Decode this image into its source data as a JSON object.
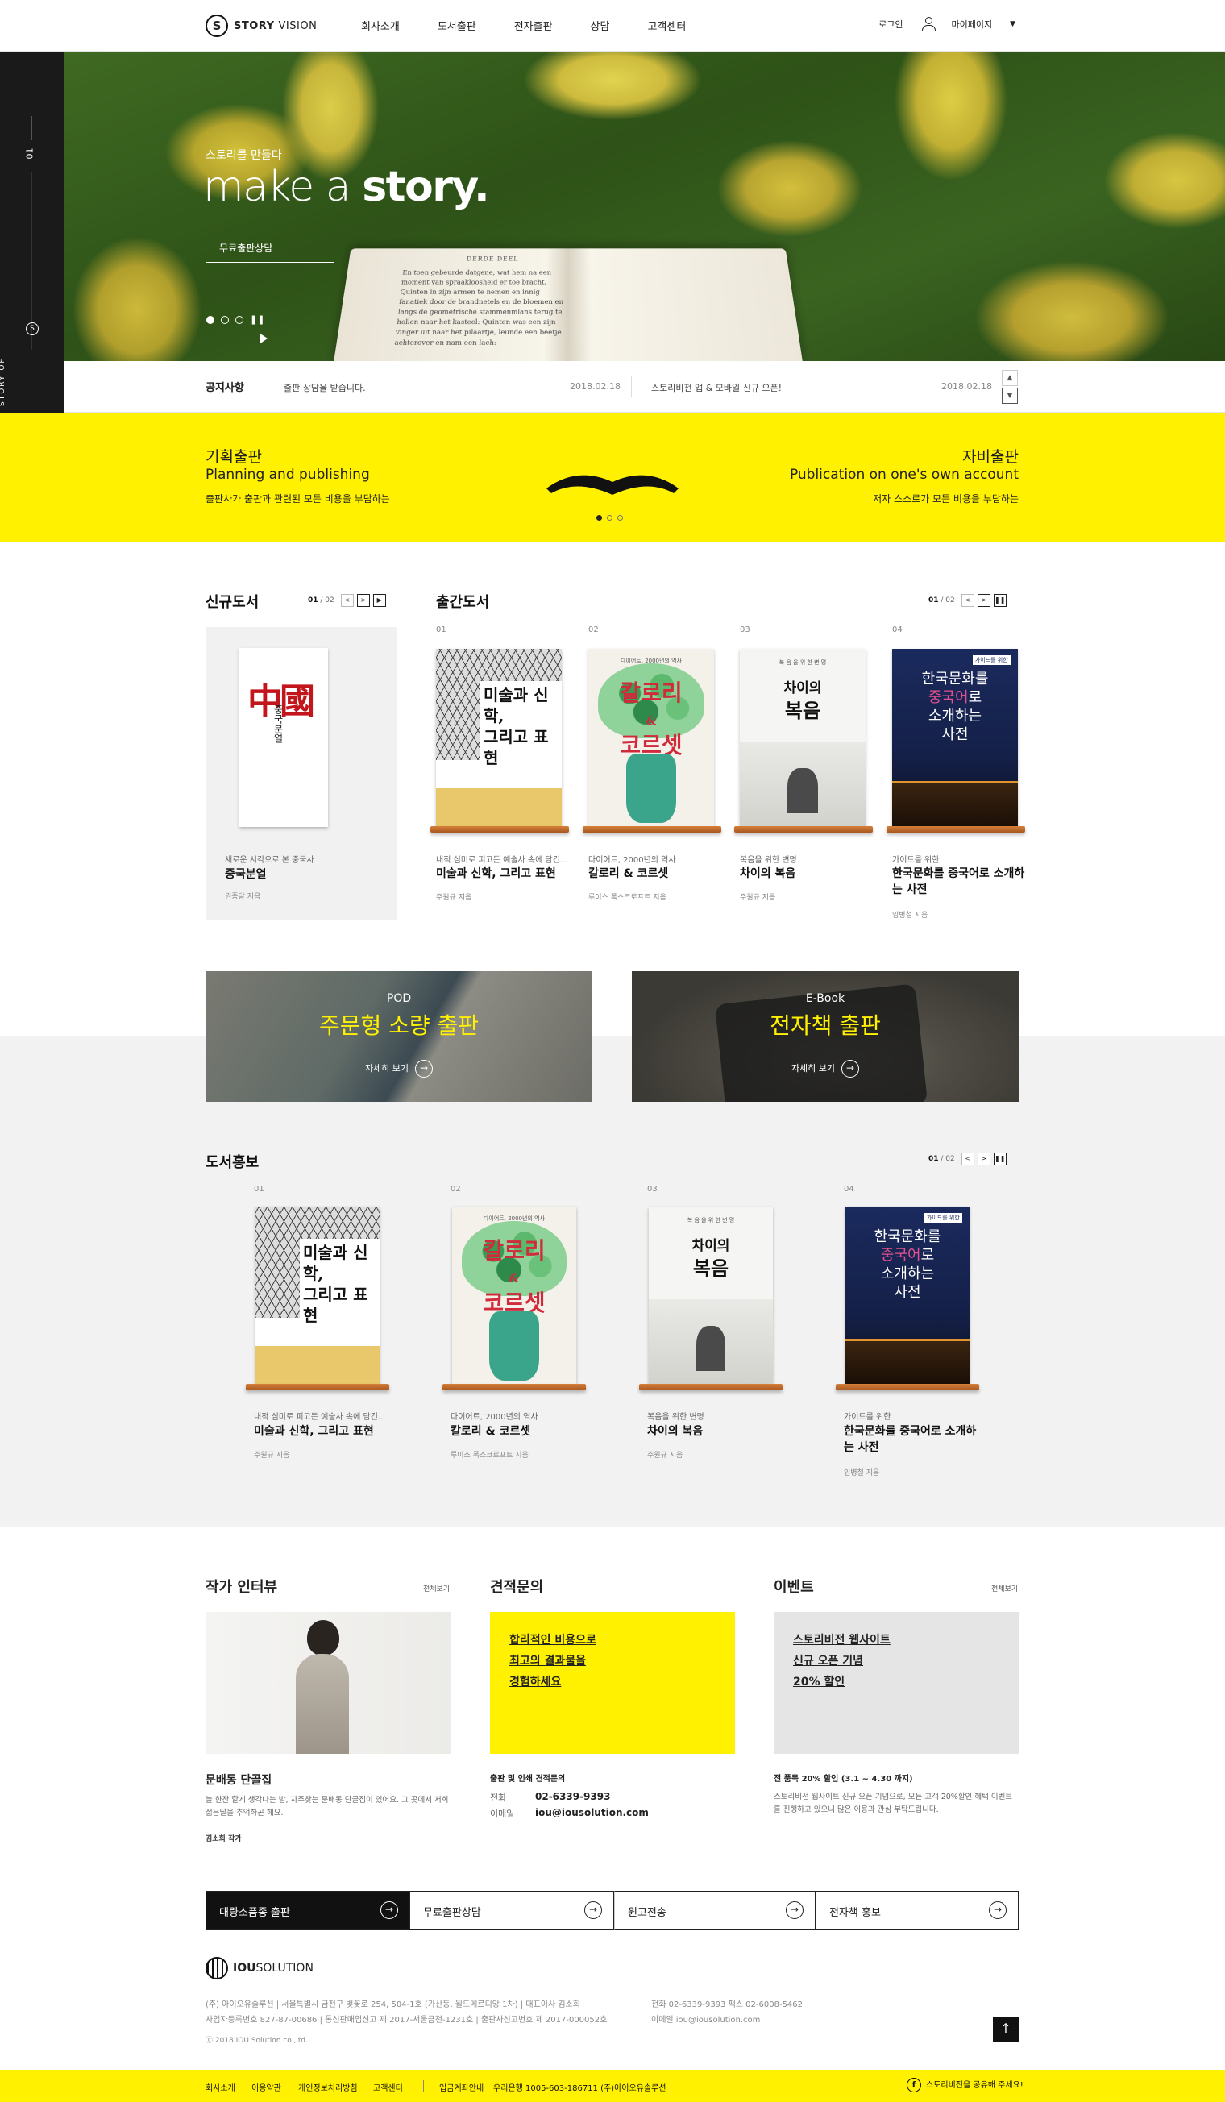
{
  "header": {
    "logo": {
      "brand_bold": "STORY",
      "brand_light": "VISION",
      "mark": "S"
    },
    "nav": [
      "회사소개",
      "도서출판",
      "전자출판",
      "상담",
      "고객센터"
    ],
    "login": "로그인",
    "mypage": "마이페이지"
  },
  "hero": {
    "page_num": "01",
    "vertical_text": "STORY OF",
    "subtitle": "스토리를 만들다",
    "title_light": "make a ",
    "title_bold": "story.",
    "cta": "무료출판상담",
    "slide_count": 3,
    "current_slide": 1,
    "book_heading": "DERDE DEEL",
    "book_text": "En toen gebeurde datgene, wat hem na een moment van spraakloosheid er toe bracht, Quinten in zijn armen te nemen en innig fanatiek door de brandnetels en de bloemen en langs de geometrische stammenmlans terug te hollen naar het kasteel: Quinten was een zijn vinger uit naar het pilaartje, leunde een beetje achterover en nam een lach:"
  },
  "notice": {
    "label": "공지사항",
    "items": [
      {
        "text": "출판 상담을 받습니다.",
        "date": "2018.02.18"
      },
      {
        "text": "스토리비전 앱 & 모바일 신규 오픈!",
        "date": "2018.02.18"
      }
    ],
    "up": "▲",
    "down": "▼"
  },
  "promo": {
    "left": {
      "title": "기획출판",
      "subtitle": "Planning and publishing",
      "desc": "출판사가 출판과 관련된 모든 비용을 부담하는"
    },
    "right": {
      "title": "자비출판",
      "subtitle": "Publication on one's own account",
      "desc": "저자 스스로가 모든 비용을 부담하는"
    },
    "dot_count": 3
  },
  "new_books": {
    "title": "신규도서",
    "page_cur": "01",
    "page_total": "02",
    "book": {
      "desc": "새로운 시각으로 본 중국사",
      "title": "중국분열",
      "author": "권중달 지음",
      "cover_text": "中國",
      "cover_sub": "중국분열"
    }
  },
  "released": {
    "title": "출간도서",
    "page_cur": "01",
    "page_total": "02",
    "books": [
      {
        "no": "01",
        "desc": "내적 심미로 피고든 예술사 속에 담긴...",
        "title": "미술과 신학, 그리고 표현",
        "author": "주원규 지음"
      },
      {
        "no": "02",
        "desc": "다이어트, 2000년의 역사",
        "title": "칼로리 & 코르셋",
        "author": "루이스 폭스크로프트 지음"
      },
      {
        "no": "03",
        "desc": "복음을 위한 변명",
        "title": "차이의 복음",
        "author": "주원규 지음"
      },
      {
        "no": "04",
        "desc": "가이드를 위한",
        "title": "한국문화를 중국어로 소개하는 사전",
        "author": "임병철 지음"
      }
    ]
  },
  "cover_text": {
    "art_title1": "미술과 신학,",
    "art_title2": "그리고 표현",
    "cal_top": "다이어트, 2000년의 역사",
    "cal_title1": "칼로리",
    "cal_amp": "&",
    "cal_title2": "코르셋",
    "diff_top": "복 음 을 위 한 변 명",
    "diff_title1": "차이의",
    "diff_title2": "복음",
    "kor_tag": "가이드를 위한",
    "kor_t1": "한국문화를",
    "kor_t2a": "중국어",
    "kor_t2b": "로",
    "kor_t3": "소개하는",
    "kor_t4": "사전"
  },
  "banners": [
    {
      "label": "POD",
      "title": "주문형 소량 출판",
      "more": "자세히 보기"
    },
    {
      "label": "E-Book",
      "title": "전자책 출판",
      "more": "자세히 보기"
    }
  ],
  "promo_books": {
    "title": "도서홍보",
    "page_cur": "01",
    "page_total": "02",
    "books": [
      {
        "no": "01",
        "desc": "내적 심미로 피고든 예술사 속에 담긴...",
        "title": "미술과 신학, 그리고 표현",
        "author": "주원규 지음"
      },
      {
        "no": "02",
        "desc": "다이어트, 2000년의 역사",
        "title": "칼로리 & 코르셋",
        "author": "루이스 폭스크로프트 지음"
      },
      {
        "no": "03",
        "desc": "복음을 위한 변명",
        "title": "차이의 복음",
        "author": "주원규 지음"
      },
      {
        "no": "04",
        "desc": "가이드를 위한",
        "title": "한국문화를 중국어로 소개하는 사전",
        "author": "임병철 지음"
      }
    ]
  },
  "interview": {
    "title": "작가 인터뷰",
    "all": "전체보기",
    "name": "문배동 단골집",
    "desc": "늘 한잔 할게 생각나는 밤, 자주찾는 문배동 단골집이 있어요. 그 곳에서 저희 젊은날을 추억하곤 해요.",
    "author": "김소희 작가"
  },
  "estimate": {
    "title": "견적문의",
    "box_lines": [
      "합리적인 비용으로",
      "최고의 결과물을",
      "경험하세요"
    ],
    "sub": "출판 및 인쇄 견적문의",
    "phone_label": "전화",
    "phone": "02-6339-9393",
    "email_label": "이메일",
    "email": "iou@iousolution.com"
  },
  "event": {
    "title": "이벤트",
    "all": "전체보기",
    "box_lines": [
      "스토리비전 웹사이트",
      "신규 오픈 기념",
      "20% 할인"
    ],
    "headline": "전 품목 20% 할인 (3.1 ~ 4.30 까지)",
    "desc": "스토리비전 웹사이트 신규 오픈 기념으로, 모든 고객 20%할인 혜택 이벤트를 진행하고 있으니 많은 이용과 관심 부탁드립니다."
  },
  "quick_links": [
    "대량소품종 출판",
    "무료출판상담",
    "원고전송",
    "전자책 홍보"
  ],
  "footer": {
    "logo_bold": "IOU",
    "logo_light": "SOLUTION",
    "line1": "(주) 아이오유솔루션  |  서울특별시 금천구 벚꽃로 254, 504-1호 (가산동, 월드메르디앙 1차)  |  대표이사 김소희",
    "line2": "사업자등록번호 827-87-00686  |  통신판매업신고 제 2017-서울금천-1231호  |  출판사신고번호 제 2017-000052호",
    "copyright": "ⓒ 2018 IOU Solution co.,ltd.",
    "tel": "전화 02-6339-9393  팩스 02-6008-5462",
    "mail": "이메일 iou@iousolution.com",
    "bar_links": [
      "회사소개",
      "이용약관",
      "개인정보처리방침",
      "고객센터",
      "입금계좌안내"
    ],
    "bank": "우리은행 1005-603-186711 (주)아이오유솔루션",
    "share": "스토리비전을 공유해 주세요!"
  }
}
